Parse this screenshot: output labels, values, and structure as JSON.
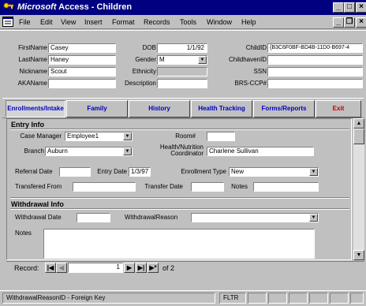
{
  "window": {
    "title_brand": "Microsoft",
    "title_rest": " Access - Children",
    "minimize": "_",
    "maximize": "□",
    "close": "×"
  },
  "menu": [
    "File",
    "Edit",
    "View",
    "Insert",
    "Format",
    "Records",
    "Tools",
    "Window",
    "Help"
  ],
  "doc_controls": {
    "minimize": "_",
    "restore": "❐",
    "close": "×"
  },
  "header": {
    "first_name_label": "FirstName",
    "first_name": "Casey",
    "last_name_label": "LastName",
    "last_name": "Haney",
    "nickname_label": "Nickname",
    "nickname": "Scout",
    "aka_label": "AKAName",
    "aka": "",
    "dob_label": "DOB",
    "dob": "1/1/92",
    "gender_label": "Gender",
    "gender": "M",
    "ethnicity_label": "Ethnicity",
    "ethnicity": "",
    "description_label": "Description",
    "description": "",
    "child_id_label": "ChildID",
    "child_id": "{B3C6F0BF-BD4B-11D0-B697-4",
    "childhaven_id_label": "ChildhavenID",
    "childhaven_id": "",
    "ssn_label": "SSN",
    "ssn": "",
    "brs_label": "BRS-CCP#",
    "brs": ""
  },
  "tabs": [
    {
      "label": "Enrollments/Intake",
      "color": "#0000c0"
    },
    {
      "label": "Family",
      "color": "#0000c0"
    },
    {
      "label": "History",
      "color": "#0000c0"
    },
    {
      "label": "Health Tracking",
      "color": "#0000c0"
    },
    {
      "label": "Forms/Reports",
      "color": "#0000c0"
    },
    {
      "label": "Exit",
      "color": "#c00000"
    }
  ],
  "entry": {
    "title": "Entry Info",
    "case_manager_label": "Case Manager",
    "case_manager": "Employee1",
    "room_label": "Room#",
    "room": "",
    "branch_label": "Branch",
    "branch": "Auburn",
    "health_label_1": "Health/Nutrition",
    "health_label_2": "Coordinator",
    "health": "Charlene Sullivan",
    "referral_label": "Referral Date",
    "referral": "",
    "entry_date_label": "Entry Date",
    "entry_date": "1/3/97",
    "enrollment_type_label": "Enrollment Type",
    "enrollment_type": "New",
    "transfered_from_label": "Transfered From",
    "transfered_from": "",
    "transfer_date_label": "Transfer Date",
    "transfer_date": "",
    "notes_label": "Notes",
    "notes": ""
  },
  "withdrawal": {
    "title": "Withdrawal Info",
    "date_label": "Withdrawal Date",
    "date": "",
    "reason_label": "WithdrawalReason",
    "reason": "",
    "notes_label": "Notes",
    "notes": ""
  },
  "navigator": {
    "label": "Record:",
    "current": "1",
    "of_text": "of 2",
    "first": "|◀",
    "prev": "◀",
    "next": "▶",
    "last": "▶|",
    "new": "▶*"
  },
  "status": {
    "text": "WithdrawalReasonID - Foreign Key",
    "filter": "FLTR"
  }
}
